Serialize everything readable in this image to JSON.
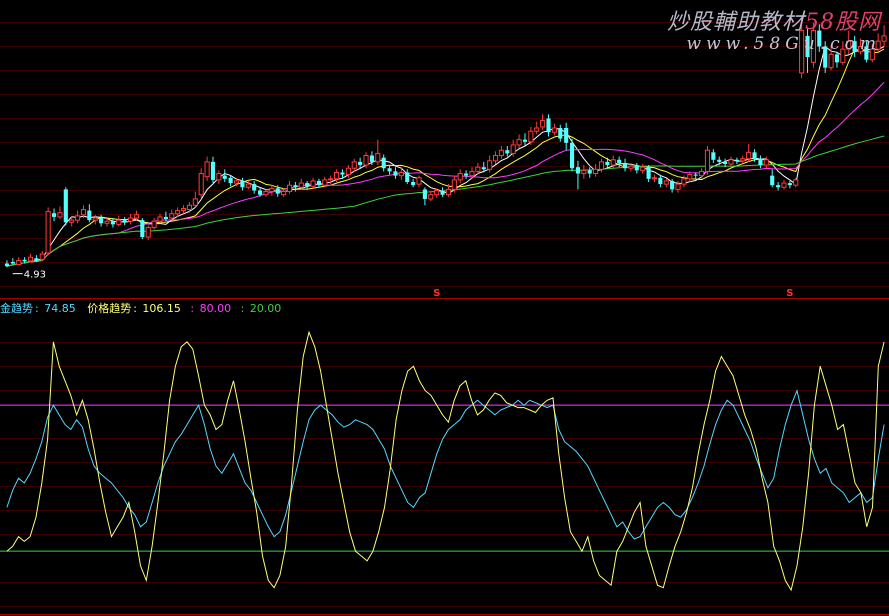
{
  "watermark": {
    "title": "炒股輔助教材",
    "brand": "58股网",
    "url": "www.58Gu.com"
  },
  "indicator_header": {
    "label1": "金趋势",
    "value1": "74.85",
    "label2": "价格趋势",
    "value2": "106.15",
    "level_high": "80.00",
    "level_low": "20.00"
  },
  "markers": {
    "low_label": "4.93",
    "signal_glyph": "S"
  },
  "colors": {
    "background": "#000000",
    "up_candle": "#ff3c3c",
    "down_candle": "#54ffff",
    "ma_short": "#ffffff",
    "ma_mid": "#ffff3c",
    "ma_long": "#ff3cff",
    "ma_slow": "#3cd23c",
    "line_gold": "#ffff78",
    "line_price": "#54d8ff",
    "level_high": "#ff3cff",
    "level_low": "#3cd23c",
    "separator": "#a00000",
    "signal": "#ff3232"
  },
  "chart_data": [
    {
      "type": "candlestick",
      "y_range": [
        4.5,
        9.6
      ],
      "grid": false,
      "low_label_at_candle": 2,
      "signal_candles": [
        73,
        133
      ],
      "candles": [
        [
          5.0,
          4.95,
          5.06,
          4.93
        ],
        [
          5.03,
          5.0,
          5.1,
          4.98
        ],
        [
          4.98,
          5.06,
          5.12,
          4.96
        ],
        [
          5.07,
          5.04,
          5.12,
          5.0
        ],
        [
          5.05,
          5.12,
          5.18,
          5.02
        ],
        [
          5.1,
          5.06,
          5.16,
          5.03
        ],
        [
          5.08,
          5.18,
          5.24,
          5.05
        ],
        [
          5.2,
          5.98,
          6.06,
          5.16
        ],
        [
          5.95,
          5.88,
          6.04,
          5.8
        ],
        [
          5.88,
          5.96,
          6.08,
          5.84
        ],
        [
          6.4,
          5.78,
          6.44,
          5.72
        ],
        [
          5.78,
          5.82,
          5.9,
          5.7
        ],
        [
          5.82,
          5.9,
          6.0,
          5.76
        ],
        [
          5.92,
          6.02,
          6.1,
          5.86
        ],
        [
          6.0,
          5.82,
          6.12,
          5.78
        ],
        [
          5.82,
          5.86,
          5.92,
          5.74
        ],
        [
          5.86,
          5.76,
          5.92,
          5.7
        ],
        [
          5.76,
          5.8,
          5.86,
          5.7
        ],
        [
          5.8,
          5.74,
          5.86,
          5.68
        ],
        [
          5.74,
          5.82,
          5.9,
          5.7
        ],
        [
          5.82,
          5.78,
          5.88,
          5.72
        ],
        [
          5.8,
          5.86,
          5.94,
          5.74
        ],
        [
          5.86,
          5.92,
          6.0,
          5.82
        ],
        [
          5.82,
          5.5,
          5.86,
          5.46
        ],
        [
          5.5,
          5.68,
          5.72,
          5.44
        ],
        [
          5.68,
          5.8,
          5.86,
          5.64
        ],
        [
          5.8,
          5.88,
          5.94,
          5.76
        ],
        [
          5.88,
          5.84,
          5.98,
          5.8
        ],
        [
          5.86,
          5.94,
          6.02,
          5.82
        ],
        [
          5.94,
          6.0,
          6.06,
          5.88
        ],
        [
          6.0,
          6.04,
          6.1,
          5.94
        ],
        [
          6.02,
          6.1,
          6.16,
          5.96
        ],
        [
          6.1,
          6.22,
          6.36,
          6.06
        ],
        [
          6.3,
          6.7,
          6.8,
          6.24
        ],
        [
          6.64,
          6.92,
          7.02,
          6.56
        ],
        [
          6.92,
          6.58,
          7.02,
          6.52
        ],
        [
          6.58,
          6.7,
          6.76,
          6.5
        ],
        [
          6.66,
          6.6,
          6.78,
          6.54
        ],
        [
          6.62,
          6.52,
          6.66,
          6.46
        ],
        [
          6.52,
          6.56,
          6.62,
          6.46
        ],
        [
          6.56,
          6.44,
          6.62,
          6.38
        ],
        [
          6.44,
          6.5,
          6.56,
          6.4
        ],
        [
          6.5,
          6.38,
          6.56,
          6.32
        ],
        [
          6.38,
          6.3,
          6.44,
          6.26
        ],
        [
          6.3,
          6.36,
          6.4,
          6.26
        ],
        [
          6.36,
          6.42,
          6.48,
          6.28
        ],
        [
          6.42,
          6.32,
          6.48,
          6.26
        ],
        [
          6.3,
          6.36,
          6.42,
          6.26
        ],
        [
          6.36,
          6.48,
          6.56,
          6.32
        ],
        [
          6.48,
          6.44,
          6.54,
          6.36
        ],
        [
          6.44,
          6.52,
          6.6,
          6.4
        ],
        [
          6.52,
          6.46,
          6.56,
          6.4
        ],
        [
          6.46,
          6.56,
          6.62,
          6.42
        ],
        [
          6.56,
          6.48,
          6.6,
          6.44
        ],
        [
          6.48,
          6.58,
          6.64,
          6.44
        ],
        [
          6.58,
          6.6,
          6.66,
          6.5
        ],
        [
          6.6,
          6.72,
          6.78,
          6.54
        ],
        [
          6.72,
          6.68,
          6.78,
          6.6
        ],
        [
          6.68,
          6.8,
          6.86,
          6.62
        ],
        [
          6.8,
          6.92,
          6.98,
          6.74
        ],
        [
          6.92,
          6.86,
          7.0,
          6.8
        ],
        [
          6.86,
          7.04,
          7.1,
          6.8
        ],
        [
          7.04,
          6.92,
          7.12,
          6.86
        ],
        [
          6.92,
          7.08,
          7.34,
          6.86
        ],
        [
          7.0,
          6.8,
          7.06,
          6.74
        ],
        [
          6.8,
          6.74,
          6.86,
          6.68
        ],
        [
          6.74,
          6.66,
          6.82,
          6.6
        ],
        [
          6.66,
          6.72,
          6.8,
          6.58
        ],
        [
          6.72,
          6.54,
          6.78,
          6.5
        ],
        [
          6.54,
          6.48,
          6.6,
          6.44
        ],
        [
          6.5,
          6.62,
          6.66,
          6.44
        ],
        [
          6.4,
          6.22,
          6.44,
          6.1
        ],
        [
          6.22,
          6.3,
          6.36,
          6.18
        ],
        [
          6.3,
          6.38,
          6.42,
          6.24
        ],
        [
          6.38,
          6.3,
          6.44,
          6.26
        ],
        [
          6.3,
          6.4,
          6.5,
          6.26
        ],
        [
          6.4,
          6.58,
          6.66,
          6.34
        ],
        [
          6.58,
          6.7,
          6.78,
          6.52
        ],
        [
          6.7,
          6.66,
          6.76,
          6.6
        ],
        [
          6.66,
          6.74,
          6.82,
          6.6
        ],
        [
          6.74,
          6.82,
          6.9,
          6.68
        ],
        [
          6.82,
          6.78,
          6.92,
          6.72
        ],
        [
          6.78,
          6.94,
          7.04,
          6.72
        ],
        [
          6.94,
          7.04,
          7.12,
          6.88
        ],
        [
          7.04,
          7.14,
          7.22,
          6.98
        ],
        [
          7.14,
          7.08,
          7.22,
          7.02
        ],
        [
          7.08,
          7.24,
          7.34,
          7.02
        ],
        [
          7.24,
          7.34,
          7.44,
          7.18
        ],
        [
          7.34,
          7.3,
          7.46,
          7.22
        ],
        [
          7.3,
          7.5,
          7.58,
          7.24
        ],
        [
          7.5,
          7.56,
          7.68,
          7.44
        ],
        [
          7.58,
          7.7,
          7.82,
          7.52
        ],
        [
          7.74,
          7.48,
          7.82,
          7.4
        ],
        [
          7.48,
          7.56,
          7.64,
          7.42
        ],
        [
          7.56,
          7.36,
          7.62,
          7.3
        ],
        [
          7.56,
          7.28,
          7.66,
          7.14
        ],
        [
          7.28,
          6.8,
          7.36,
          6.74
        ],
        [
          6.82,
          6.7,
          6.94,
          6.4
        ],
        [
          6.7,
          6.76,
          6.86,
          6.6
        ],
        [
          6.76,
          6.7,
          6.82,
          6.62
        ],
        [
          6.7,
          6.78,
          6.88,
          6.64
        ],
        [
          6.78,
          6.92,
          6.98,
          6.72
        ],
        [
          6.92,
          6.86,
          7.0,
          6.8
        ],
        [
          6.86,
          6.96,
          7.04,
          6.8
        ],
        [
          6.96,
          6.9,
          7.02,
          6.82
        ],
        [
          6.9,
          6.8,
          6.98,
          6.74
        ],
        [
          6.8,
          6.84,
          6.9,
          6.74
        ],
        [
          6.84,
          6.76,
          6.9,
          6.7
        ],
        [
          6.76,
          6.82,
          6.88,
          6.7
        ],
        [
          6.82,
          6.6,
          6.86,
          6.54
        ],
        [
          6.6,
          6.62,
          6.68,
          6.54
        ],
        [
          6.62,
          6.5,
          6.68,
          6.44
        ],
        [
          6.5,
          6.56,
          6.6,
          6.44
        ],
        [
          6.56,
          6.4,
          6.6,
          6.34
        ],
        [
          6.4,
          6.5,
          6.56,
          6.34
        ],
        [
          6.5,
          6.6,
          6.66,
          6.44
        ],
        [
          6.6,
          6.68,
          6.74,
          6.54
        ],
        [
          6.68,
          6.66,
          6.72,
          6.6
        ],
        [
          6.66,
          6.74,
          6.8,
          6.6
        ],
        [
          6.74,
          7.14,
          7.22,
          6.68
        ],
        [
          7.1,
          6.96,
          7.16,
          6.9
        ],
        [
          6.96,
          6.92,
          7.02,
          6.86
        ],
        [
          6.92,
          6.88,
          6.98,
          6.82
        ],
        [
          6.88,
          6.96,
          7.02,
          6.84
        ],
        [
          6.96,
          6.94,
          7.0,
          6.88
        ],
        [
          6.94,
          6.98,
          7.04,
          6.9
        ],
        [
          6.98,
          7.1,
          7.26,
          6.92
        ],
        [
          7.1,
          6.98,
          7.16,
          6.92
        ],
        [
          6.98,
          6.86,
          7.04,
          6.8
        ],
        [
          6.86,
          6.96,
          7.02,
          6.8
        ],
        [
          6.66,
          6.48,
          6.78,
          6.44
        ],
        [
          6.48,
          6.44,
          6.54,
          6.38
        ],
        [
          6.44,
          6.52,
          6.58,
          6.4
        ],
        [
          6.52,
          6.48,
          6.56,
          6.42
        ],
        [
          6.48,
          6.58,
          6.62,
          6.44
        ],
        [
          8.6,
          9.4,
          9.62,
          8.5
        ],
        [
          9.3,
          8.9,
          9.45,
          8.6
        ],
        [
          8.8,
          9.4,
          9.55,
          8.7
        ],
        [
          9.4,
          9.1,
          9.52,
          9.0
        ],
        [
          9.1,
          8.7,
          9.2,
          8.6
        ],
        [
          8.7,
          8.95,
          9.1,
          8.65
        ],
        [
          8.95,
          8.8,
          9.0,
          8.7
        ],
        [
          8.8,
          9.05,
          9.2,
          8.75
        ],
        [
          9.05,
          9.2,
          9.4,
          8.95
        ],
        [
          9.2,
          9.0,
          9.3,
          8.9
        ],
        [
          9.0,
          9.1,
          9.25,
          8.95
        ],
        [
          9.1,
          8.85,
          9.2,
          8.8
        ],
        [
          8.85,
          9.05,
          9.15,
          8.8
        ],
        [
          9.05,
          9.2,
          9.35,
          9.0
        ],
        [
          9.2,
          9.3,
          9.5,
          9.1
        ]
      ],
      "moving_averages": [
        {
          "name": "MA5",
          "period": 5
        },
        {
          "name": "MA10",
          "period": 10
        },
        {
          "name": "MA20",
          "period": 20
        },
        {
          "name": "MA60",
          "period": 60
        }
      ]
    },
    {
      "type": "line",
      "y_range": [
        -5,
        115
      ],
      "levels": [
        80,
        20
      ],
      "series": [
        {
          "name": "金趋势",
          "values": [
            38,
            45,
            50,
            48,
            52,
            58,
            65,
            75,
            80,
            76,
            72,
            70,
            74,
            71,
            62,
            55,
            52,
            50,
            48,
            45,
            42,
            38,
            35,
            30,
            32,
            40,
            48,
            55,
            60,
            65,
            68,
            72,
            76,
            80,
            72,
            62,
            55,
            52,
            56,
            60,
            54,
            48,
            45,
            40,
            35,
            30,
            26,
            28,
            35,
            45,
            55,
            65,
            74,
            78,
            80,
            78,
            76,
            73,
            71,
            72,
            74,
            73,
            72,
            70,
            66,
            62,
            55,
            50,
            45,
            40,
            38,
            42,
            44,
            52,
            60,
            66,
            70,
            72,
            74,
            78,
            80,
            82,
            80,
            78,
            76,
            78,
            79,
            80,
            82,
            80,
            82,
            81,
            80,
            79,
            80,
            70,
            65,
            63,
            61,
            58,
            55,
            50,
            45,
            40,
            35,
            30,
            32,
            28,
            25,
            26,
            30,
            34,
            38,
            40,
            38,
            35,
            34,
            37,
            42,
            48,
            55,
            64,
            72,
            78,
            82,
            80,
            75,
            70,
            65,
            58,
            52,
            46,
            50,
            62,
            72,
            80,
            86,
            76,
            66,
            58,
            52,
            54,
            48,
            46,
            44,
            40,
            42,
            44,
            40,
            42,
            58,
            72
          ]
        },
        {
          "name": "价格趋势",
          "values": [
            20,
            22,
            26,
            24,
            26,
            34,
            48,
            66,
            106,
            96,
            90,
            84,
            76,
            82,
            74,
            62,
            48,
            36,
            26,
            30,
            34,
            40,
            28,
            14,
            8,
            22,
            40,
            60,
            82,
            96,
            104,
            106,
            103,
            92,
            80,
            76,
            70,
            72,
            82,
            90,
            78,
            65,
            50,
            36,
            18,
            8,
            5,
            10,
            22,
            48,
            78,
            100,
            110,
            104,
            94,
            80,
            66,
            52,
            40,
            28,
            20,
            18,
            16,
            20,
            28,
            38,
            54,
            74,
            86,
            94,
            96,
            90,
            86,
            84,
            80,
            76,
            73,
            82,
            88,
            90,
            82,
            76,
            78,
            82,
            85,
            84,
            81,
            80,
            79,
            79,
            78,
            77,
            80,
            82,
            83,
            60,
            42,
            28,
            24,
            20,
            26,
            16,
            10,
            8,
            6,
            20,
            24,
            30,
            36,
            40,
            22,
            14,
            6,
            5,
            14,
            22,
            28,
            36,
            46,
            60,
            72,
            82,
            94,
            100,
            96,
            92,
            84,
            76,
            70,
            62,
            50,
            40,
            22,
            16,
            8,
            4,
            14,
            30,
            52,
            80,
            96,
            88,
            80,
            70,
            72,
            60,
            48,
            44,
            30,
            38,
            96,
            106
          ]
        }
      ]
    }
  ]
}
